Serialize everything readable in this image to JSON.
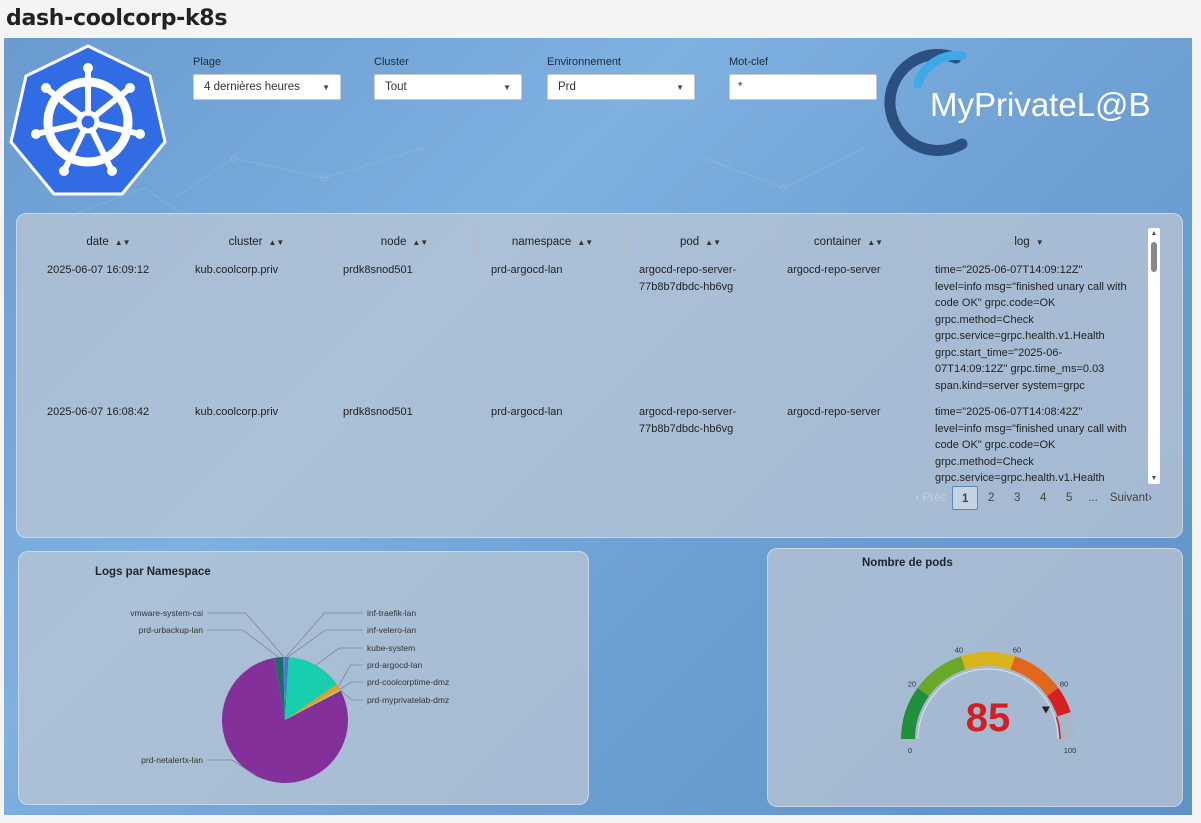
{
  "page": {
    "title": "dash-coolcorp-k8s"
  },
  "filters": {
    "plage": {
      "label": "Plage",
      "value": "4 dernières heures"
    },
    "cluster": {
      "label": "Cluster",
      "value": "Tout"
    },
    "environnement": {
      "label": "Environnement",
      "value": "Prd"
    },
    "motclef": {
      "label": "Mot-clef",
      "value": "*"
    }
  },
  "brand": {
    "text": "MyPrivateL@B",
    "colors": {
      "ring": "#2d5a8c",
      "accent": "#3fa8e8"
    }
  },
  "table": {
    "columns": [
      "date",
      "cluster",
      "node",
      "namespace",
      "pod",
      "container",
      "log"
    ],
    "rows": [
      {
        "date": "2025-06-07 16:09:12",
        "cluster": "kub.coolcorp.priv",
        "node": "prdk8snod501",
        "namespace": "prd-argocd-lan",
        "pod": "argocd-repo-server-77b8b7dbdc-hb6vg",
        "container": "argocd-repo-server",
        "log": "time=\"2025-06-07T14:09:12Z\" level=info msg=\"finished unary call with code OK\" grpc.code=OK grpc.method=Check grpc.service=grpc.health.v1.Health grpc.start_time=\"2025-06-07T14:09:12Z\" grpc.time_ms=0.03 span.kind=server system=grpc"
      },
      {
        "date": "2025-06-07 16:08:42",
        "cluster": "kub.coolcorp.priv",
        "node": "prdk8snod501",
        "namespace": "prd-argocd-lan",
        "pod": "argocd-repo-server-77b8b7dbdc-hb6vg",
        "container": "argocd-repo-server",
        "log": "time=\"2025-06-07T14:08:42Z\" level=info msg=\"finished unary call with code OK\" grpc.code=OK grpc.method=Check grpc.service=grpc.health.v1.Health"
      }
    ]
  },
  "pagination": {
    "prev": "‹ Préc",
    "pages": [
      "1",
      "2",
      "3",
      "4",
      "5"
    ],
    "ellipsis": "...",
    "next": "Suivant›",
    "current": "1"
  },
  "pie": {
    "title": "Logs par Namespace",
    "chart_data": {
      "type": "pie",
      "title": "Logs par Namespace",
      "slices": [
        {
          "label": "inf-traefik-lan",
          "value": 0.5,
          "color": "#7a5cc4"
        },
        {
          "label": "inf-velero-lan",
          "value": 0.4,
          "color": "#3f6fd0"
        },
        {
          "label": "kube-system",
          "value": 14.5,
          "color": "#18cfad"
        },
        {
          "label": "prd-argocd-lan",
          "value": 1.3,
          "color": "#e59b2e"
        },
        {
          "label": "prd-coolcorptime-dmz",
          "value": 0.3,
          "color": "#c9c12c"
        },
        {
          "label": "prd-myprivatelab-dmz",
          "value": 0.3,
          "color": "#a6d36b"
        },
        {
          "label": "prd-netalertx-lan",
          "value": 80.0,
          "color": "#83309a"
        },
        {
          "label": "prd-urbackup-lan",
          "value": 2.2,
          "color": "#1f6b6a"
        },
        {
          "label": "vmware-system-csi",
          "value": 0.5,
          "color": "#3a8fbf"
        }
      ]
    }
  },
  "gauge": {
    "title": "Nombre de pods",
    "chart_data": {
      "type": "gauge",
      "title": "Nombre de pods",
      "value": 85,
      "min": 0,
      "max": 100,
      "ticks": [
        "0",
        "20",
        "40",
        "60",
        "80",
        "100"
      ],
      "bands": [
        {
          "from": 0,
          "to": 20,
          "color": "#1f8f3a"
        },
        {
          "from": 20,
          "to": 40,
          "color": "#6aa82a"
        },
        {
          "from": 40,
          "to": 60,
          "color": "#d8b419"
        },
        {
          "from": 60,
          "to": 80,
          "color": "#e3671b"
        },
        {
          "from": 80,
          "to": 90,
          "color": "#d81f1f"
        },
        {
          "from": 90,
          "to": 100,
          "color": "#a8b6c8"
        }
      ],
      "value_color": "#d21f1f"
    }
  }
}
